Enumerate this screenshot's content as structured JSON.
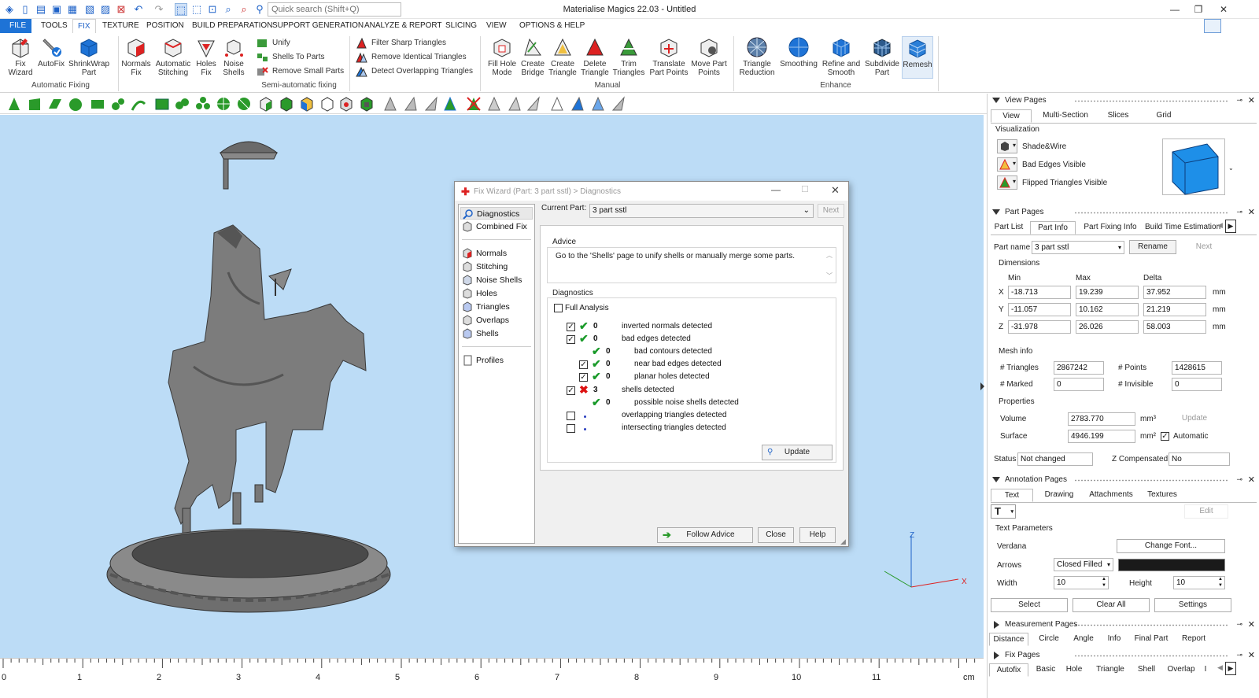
{
  "app": {
    "title": "Materialise Magics 22.03 - Untitled",
    "search_placeholder": "Quick search (Shift+Q)"
  },
  "menu": [
    "FILE",
    "TOOLS",
    "FIX",
    "TEXTURE",
    "POSITION",
    "BUILD PREPARATION",
    "SUPPORT GENERATION",
    "ANALYZE & REPORT",
    "SLICING",
    "VIEW",
    "OPTIONS & HELP"
  ],
  "ribbon": {
    "auto": {
      "label": "Automatic Fixing",
      "items": [
        "Fix\nWizard",
        "AutoFix",
        "ShrinkWrap\nPart"
      ]
    },
    "semi": {
      "label": "Semi-automatic fixing",
      "items": [
        "Normals\nFix",
        "Automatic\nStitching",
        "Holes\nFix",
        "Noise\nShells"
      ],
      "small": [
        "Unify",
        "Shells To Parts",
        "Remove Small Parts"
      ],
      "small2": [
        "Filter Sharp Triangles",
        "Remove Identical Triangles",
        "Detect Overlapping Triangles"
      ]
    },
    "manual": {
      "label": "Manual",
      "items": [
        "Fill Hole\nMode",
        "Create\nBridge",
        "Create\nTriangle",
        "Delete\nTriangle",
        "Trim\nTriangles",
        "Translate\nPart Points",
        "Move Part\nPoints"
      ]
    },
    "enhance": {
      "label": "Enhance",
      "items": [
        "Triangle\nReduction",
        "Smoothing",
        "Refine and\nSmooth",
        "Subdivide\nPart",
        "Remesh"
      ]
    }
  },
  "ruler": {
    "marks": [
      "0",
      "1",
      "2",
      "3",
      "4",
      "5",
      "6",
      "7",
      "8",
      "9",
      "10",
      "11"
    ],
    "unit": "cm"
  },
  "dialog": {
    "title": "Fix Wizard (Part: 3 part sstl) > Diagnostics",
    "nav": [
      "Diagnostics",
      "Combined Fix",
      "Normals",
      "Stitching",
      "Noise Shells",
      "Holes",
      "Triangles",
      "Overlaps",
      "Shells",
      "Profiles"
    ],
    "current_part_label": "Current Part:",
    "current_part": "3 part sstl",
    "next": "Next",
    "advice_label": "Advice",
    "advice": "Go to the 'Shells' page to unify shells or manually merge some parts.",
    "diagnostics_label": "Diagnostics",
    "full_analysis": "Full Analysis",
    "rows": [
      {
        "count": "0",
        "text": "inverted normals detected"
      },
      {
        "count": "0",
        "text": "bad edges detected"
      },
      {
        "count": "0",
        "text": "bad contours detected"
      },
      {
        "count": "0",
        "text": "near bad edges detected"
      },
      {
        "count": "0",
        "text": "planar holes detected"
      },
      {
        "count": "3",
        "text": "shells detected"
      },
      {
        "count": "0",
        "text": "possible noise shells detected"
      },
      {
        "count": "",
        "text": "overlapping triangles detected"
      },
      {
        "count": "",
        "text": "intersecting triangles detected"
      }
    ],
    "update": "Update",
    "follow_advice": "Follow Advice",
    "close": "Close",
    "help": "Help"
  },
  "panel": {
    "view_pages": {
      "title": "View Pages",
      "tabs": [
        "View",
        "Multi-Section",
        "Slices",
        "Grid"
      ],
      "visualization": "Visualization",
      "items": [
        "Shade&Wire",
        "Bad Edges Visible",
        "Flipped Triangles Visible"
      ]
    },
    "part_pages": {
      "title": "Part Pages",
      "tabs": [
        "Part List",
        "Part Info",
        "Part Fixing Info",
        "Build Time Estimation"
      ],
      "part_name_label": "Part name",
      "part_name": "3 part sstl",
      "rename": "Rename",
      "next": "Next",
      "dimensions": "Dimensions",
      "min": "Min",
      "max": "Max",
      "delta": "Delta",
      "rows": [
        {
          "axis": "X",
          "min": "-18.713",
          "max": "19.239",
          "delta": "37.952"
        },
        {
          "axis": "Y",
          "min": "-11.057",
          "max": "10.162",
          "delta": "21.219"
        },
        {
          "axis": "Z",
          "min": "-31.978",
          "max": "26.026",
          "delta": "58.003"
        }
      ],
      "mm": "mm",
      "mesh_info": "Mesh info",
      "triangles_label": "# Triangles",
      "triangles": "2867242",
      "points_label": "# Points",
      "points": "1428615",
      "marked_label": "# Marked",
      "marked": "0",
      "invisible_label": "# Invisible",
      "invisible": "0",
      "properties": "Properties",
      "volume_label": "Volume",
      "volume": "2783.770",
      "mm3": "mm³",
      "update": "Update",
      "surface_label": "Surface",
      "surface": "4946.199",
      "mm2": "mm²",
      "automatic": "Automatic",
      "status_label": "Status",
      "status": "Not changed",
      "zcomp_label": "Z Compensated",
      "zcomp": "No"
    },
    "annotation_pages": {
      "title": "Annotation Pages",
      "tabs": [
        "Text",
        "Drawing",
        "Attachments",
        "Textures"
      ],
      "edit": "Edit",
      "text_params": "Text Parameters",
      "font": "Verdana",
      "change_font": "Change Font...",
      "arrows_label": "Arrows",
      "arrows": "Closed Filled",
      "width_label": "Width",
      "width": "10",
      "height_label": "Height",
      "height": "10",
      "select": "Select",
      "clear_all": "Clear All",
      "settings": "Settings"
    },
    "measurement_pages": {
      "title": "Measurement Pages",
      "tabs": [
        "Distance",
        "Circle",
        "Angle",
        "Info",
        "Final Part",
        "Report"
      ]
    },
    "fix_pages": {
      "title": "Fix Pages",
      "tabs": [
        "Autofix",
        "Basic",
        "Hole",
        "Triangle",
        "Shell",
        "Overlap",
        "I"
      ]
    }
  },
  "axis": {
    "z": "Z",
    "x": "X"
  }
}
